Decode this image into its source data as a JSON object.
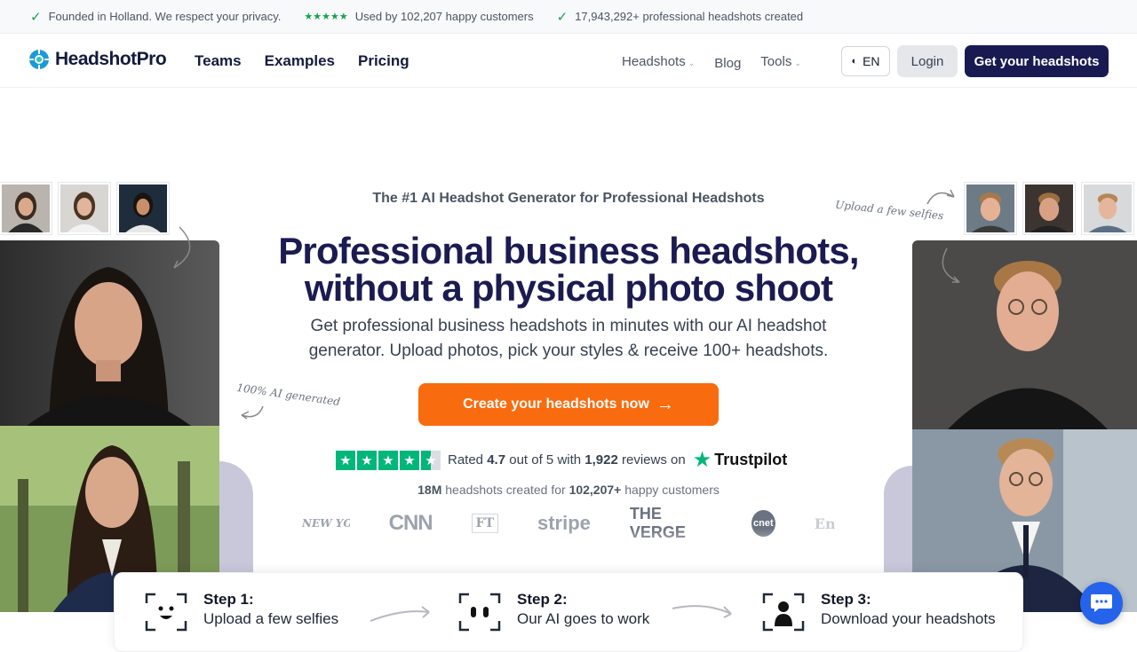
{
  "topbar": {
    "items": [
      "Founded in Holland. We respect your privacy.",
      "Used by 102,207 happy customers",
      "17,943,292+ professional headshots created"
    ],
    "stars": "★★★★★"
  },
  "nav": {
    "brand": "HeadshotPro",
    "links": [
      "Teams",
      "Examples",
      "Pricing"
    ],
    "right_links": [
      "Headshots",
      "Blog",
      "Tools"
    ],
    "lang": "EN",
    "login": "Login",
    "cta": "Get your headshots"
  },
  "hero": {
    "eyebrow": "The #1 AI Headshot Generator for Professional Headshots",
    "title_line1": "Professional business headshots,",
    "title_line2": "without a physical photo shoot",
    "subtitle": "Get professional business headshots in minutes with our AI headshot generator. Upload photos, pick your styles & receive 100+ headshots.",
    "cta": "Create your headshots now",
    "note_left": "100% AI generated",
    "note_right": "Upload a few selfies"
  },
  "rating": {
    "prefix": "Rated",
    "score": "4.7",
    "mid": "out of 5 with",
    "count": "1,922",
    "suffix": "reviews on",
    "platform": "Trustpilot"
  },
  "created": {
    "count": "18M",
    "mid": "headshots created for",
    "customers": "102,207+",
    "suffix": "happy customers"
  },
  "press": [
    "NEW YORK POST",
    "CNN",
    "FT",
    "stripe",
    "THE VERGE",
    "cnet",
    "Entrepreneur"
  ],
  "steps": [
    {
      "title": "Step 1:",
      "desc": "Upload a few selfies"
    },
    {
      "title": "Step 2:",
      "desc": "Our AI goes to work"
    },
    {
      "title": "Step 3:",
      "desc": "Download your headshots"
    }
  ],
  "colors": {
    "brand_navy": "#1a1a52",
    "cta_orange": "#f96b0f",
    "trustpilot_green": "#00b67a",
    "check_green": "#16a34a"
  }
}
